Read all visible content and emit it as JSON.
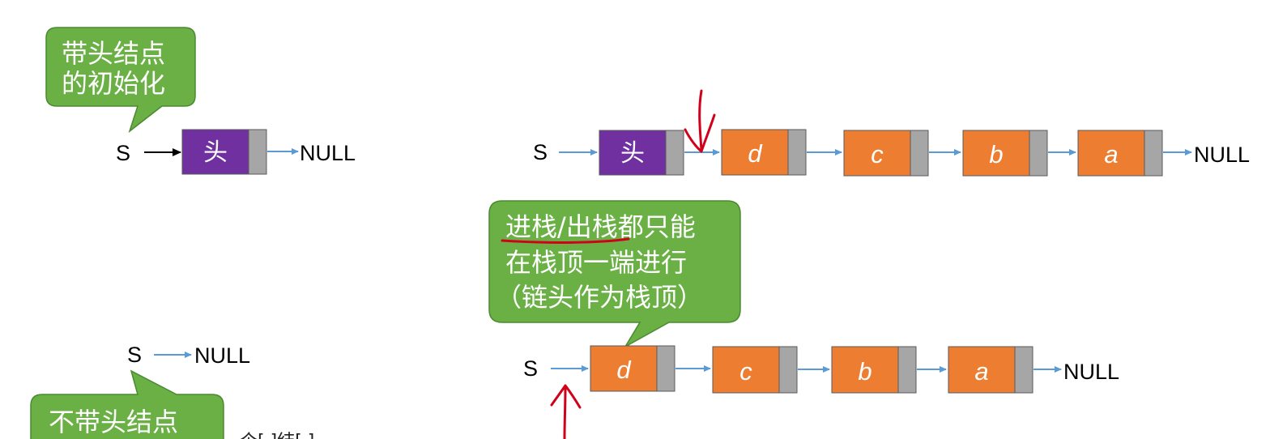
{
  "colors": {
    "bubble_fill": "#6ab045",
    "bubble_stroke": "#4a8a30",
    "head_node": "#7030a0",
    "data_node": "#ed7d31",
    "pointer_cell": "#a6a6a6",
    "arrow_blue": "#5b9bd5",
    "annotation_red": "#d0021b"
  },
  "bubbles": {
    "with_head": {
      "line1": "带头结点",
      "line2": "的初始化"
    },
    "stack_ops": {
      "line1_underlined": "进栈/出栈",
      "line1_rest": "都只能",
      "line2": "在栈顶一端进行",
      "line3": "（链头作为栈顶）"
    },
    "without_head": {
      "line1": "不带头结点"
    }
  },
  "with_head_init": {
    "pointer": "S",
    "head_label": "头",
    "terminator": "NULL"
  },
  "with_head_list": {
    "pointer": "S",
    "head_label": "头",
    "nodes": [
      "d",
      "c",
      "b",
      "a"
    ],
    "terminator": "NULL"
  },
  "without_head_init": {
    "pointer": "S",
    "terminator": "NULL"
  },
  "without_head_list": {
    "pointer": "S",
    "nodes": [
      "d",
      "c",
      "b",
      "a"
    ],
    "terminator": "NULL"
  },
  "bottom_caption": "个[  ]结[  ]"
}
